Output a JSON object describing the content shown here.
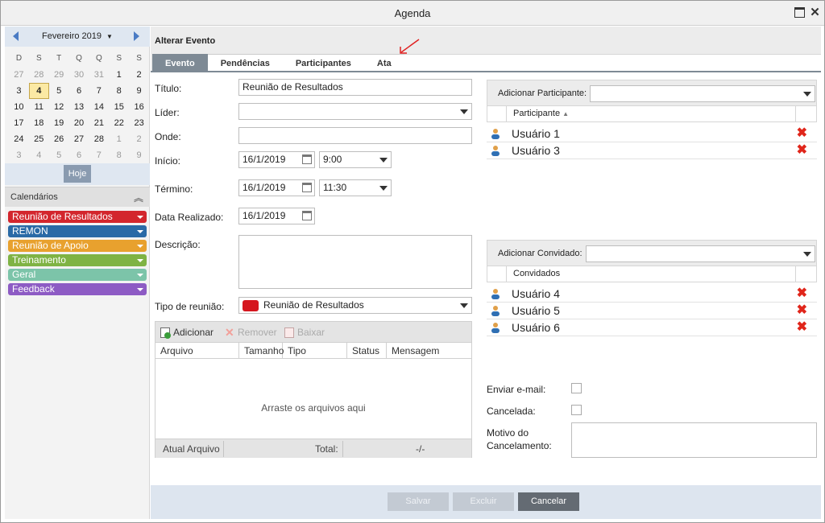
{
  "window": {
    "title": "Agenda"
  },
  "calendar": {
    "month_label": "Fevereiro 2019",
    "weekdays": [
      "D",
      "S",
      "T",
      "Q",
      "Q",
      "S",
      "S"
    ],
    "weeks": [
      [
        "27",
        "28",
        "29",
        "30",
        "31",
        "1",
        "2"
      ],
      [
        "3",
        "4",
        "5",
        "6",
        "7",
        "8",
        "9"
      ],
      [
        "10",
        "11",
        "12",
        "13",
        "14",
        "15",
        "16"
      ],
      [
        "17",
        "18",
        "19",
        "20",
        "21",
        "22",
        "23"
      ],
      [
        "24",
        "25",
        "26",
        "27",
        "28",
        "1",
        "2"
      ],
      [
        "3",
        "4",
        "5",
        "6",
        "7",
        "8",
        "9"
      ]
    ],
    "today_button": "Hoje"
  },
  "calendars": {
    "header": "Calendários",
    "items": [
      {
        "label": "Reunião de Resultados",
        "color": "#d3262d"
      },
      {
        "label": "REMON",
        "color": "#2a6aa6"
      },
      {
        "label": "Reunião de Apoio",
        "color": "#e8a12e"
      },
      {
        "label": "Treinamento",
        "color": "#7fb344"
      },
      {
        "label": "Geral",
        "color": "#7cc4a9"
      },
      {
        "label": "Feedback",
        "color": "#8d5bc4"
      }
    ]
  },
  "form": {
    "title": "Alterar Evento",
    "tabs": [
      "Evento",
      "Pendências",
      "Participantes",
      "Ata"
    ],
    "titulo_label": "Título:",
    "titulo_value": "Reunião de Resultados",
    "lider_label": "Líder:",
    "onde_label": "Onde:",
    "inicio_label": "Início:",
    "inicio_date": "16/1/2019",
    "inicio_time": "9:00",
    "termino_label": "Término:",
    "termino_date": "16/1/2019",
    "termino_time": "11:30",
    "realizado_label": "Data Realizado:",
    "realizado_date": "16/1/2019",
    "descricao_label": "Descrição:",
    "tipo_label": "Tipo de reunião:",
    "tipo_value": "Reunião de Resultados",
    "tipo_color": "#d5161e"
  },
  "attachments": {
    "toolbar": {
      "add": "Adicionar",
      "remove": "Remover",
      "download": "Baixar"
    },
    "columns": [
      "Arquivo",
      "Tamanho",
      "Tipo",
      "Status",
      "Mensagem"
    ],
    "drop_text": "Arraste os arquivos aqui",
    "footer": {
      "current": "Atual Arquivo",
      "total": "Total:",
      "progress": "-/-"
    }
  },
  "participants": {
    "add_label": "Adicionar Participante:",
    "column": "Participante",
    "rows": [
      "Usuário 1",
      "Usuário 3"
    ]
  },
  "guests": {
    "add_label": "Adicionar Convidado:",
    "column": "Convidados",
    "rows": [
      "Usuário 4",
      "Usuário 5",
      "Usuário 6"
    ]
  },
  "options": {
    "email_label": "Enviar e-mail:",
    "cancelada_label": "Cancelada:",
    "motivo_label_1": "Motivo do",
    "motivo_label_2": "Cancelamento:"
  },
  "buttons": {
    "save": "Salvar",
    "delete": "Excluir",
    "cancel": "Cancelar"
  }
}
